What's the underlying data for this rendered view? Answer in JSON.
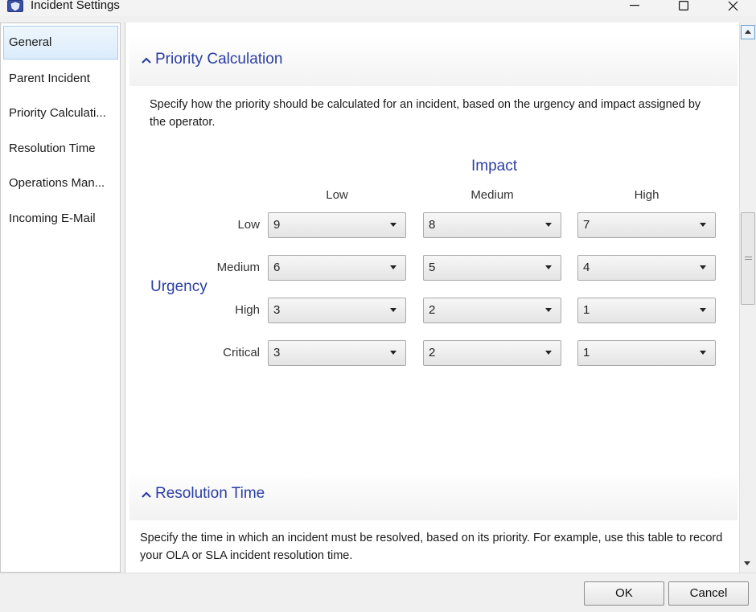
{
  "window": {
    "title": "Incident Settings",
    "icon": "app-shield-icon"
  },
  "sidebar": {
    "items": [
      {
        "label": "General",
        "selected": true
      },
      {
        "label": "Parent Incident",
        "selected": false
      },
      {
        "label": "Priority Calculati...",
        "selected": false
      },
      {
        "label": "Resolution Time",
        "selected": false
      },
      {
        "label": "Operations Man...",
        "selected": false
      },
      {
        "label": "Incoming E-Mail",
        "selected": false
      }
    ]
  },
  "priority": {
    "header": "Priority Calculation",
    "description": "Specify how the priority should be calculated for an incident, based on the urgency and impact assigned by the operator.",
    "impact_label": "Impact",
    "urgency_label": "Urgency",
    "impact_columns": [
      "Low",
      "Medium",
      "High"
    ],
    "urgency_rows": [
      "Low",
      "Medium",
      "High",
      "Critical"
    ],
    "matrix": [
      [
        "9",
        "8",
        "7"
      ],
      [
        "6",
        "5",
        "4"
      ],
      [
        "3",
        "2",
        "1"
      ],
      [
        "3",
        "2",
        "1"
      ]
    ]
  },
  "resolution": {
    "header": "Resolution Time",
    "description": "Specify the time in which an incident must be resolved, based on its priority. For example, use this table to record your OLA or SLA incident resolution time."
  },
  "buttons": {
    "ok": "OK",
    "cancel": "Cancel"
  },
  "colors": {
    "section_title": "#2b3ea3",
    "selection_border": "#a7cdf0"
  }
}
